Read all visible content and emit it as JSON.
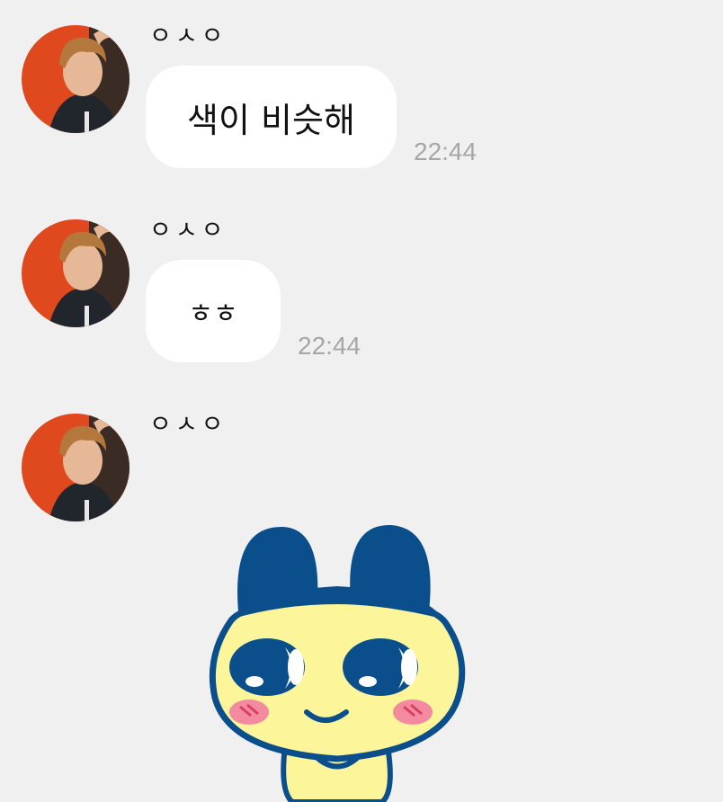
{
  "messages": [
    {
      "sender": "ㅇㅅㅇ",
      "text": "색이 비슷해",
      "time": "22:44"
    },
    {
      "sender": "ㅇㅅㅇ",
      "text": "ㅎㅎ",
      "time": "22:44"
    },
    {
      "sender": "ㅇㅅㅇ",
      "sticker": "mametchi-sticker"
    }
  ],
  "colors": {
    "background": "#f0f0f0",
    "bubble": "#ffffff",
    "timestamp": "#a6a6a6",
    "sticker_blue": "#0a4f8c",
    "sticker_yellow": "#fdf59a",
    "sticker_cheek": "#f48aa0"
  }
}
